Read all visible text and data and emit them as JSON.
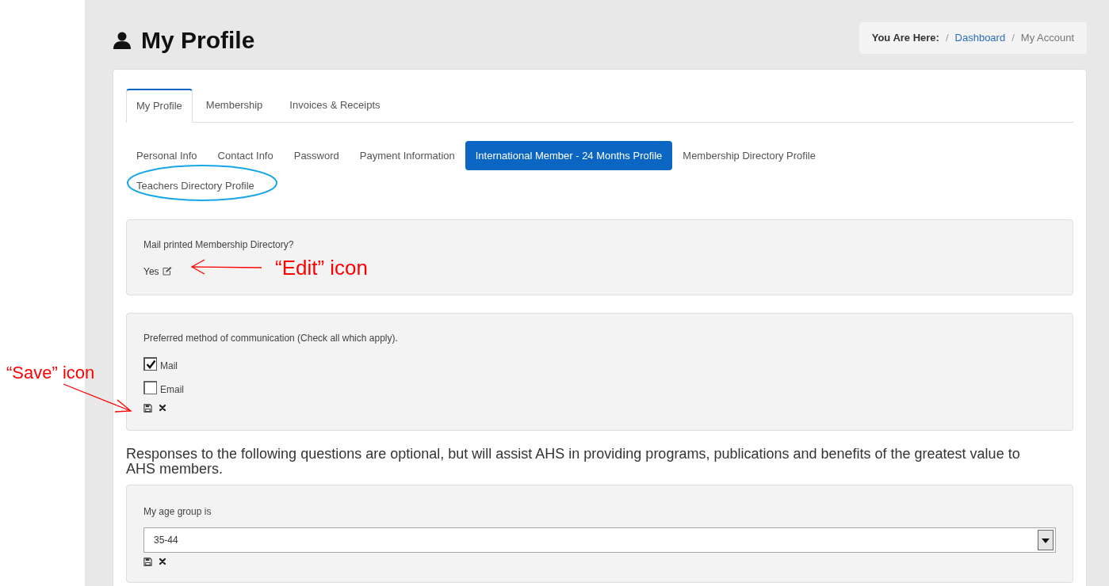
{
  "header": {
    "title": "My Profile",
    "breadcrumb": {
      "label": "You Are Here:",
      "items": [
        {
          "separator": "/",
          "text": "Dashboard",
          "kind": "link"
        },
        {
          "separator": "/",
          "text": "My Account",
          "kind": "current"
        }
      ]
    }
  },
  "tabs": [
    {
      "label": "My Profile",
      "selected": true
    },
    {
      "label": "Membership",
      "selected": false
    },
    {
      "label": "Invoices & Receipts",
      "selected": false
    }
  ],
  "subtabs": [
    {
      "label": "Personal Info",
      "selected": false
    },
    {
      "label": "Contact Info",
      "selected": false
    },
    {
      "label": "Password",
      "selected": false
    },
    {
      "label": "Payment Information",
      "selected": false
    },
    {
      "label": "International Member - 24 Months Profile",
      "selected": true
    },
    {
      "label": "Membership Directory Profile",
      "selected": false
    },
    {
      "label": "Teachers Directory Profile",
      "selected": false
    }
  ],
  "directory_question": {
    "label": "Mail printed Membership Directory?",
    "value": "Yes"
  },
  "communication": {
    "label": "Preferred method of communication (Check all which apply).",
    "options": [
      {
        "label": "Mail",
        "checked": true
      },
      {
        "label": "Email",
        "checked": false
      }
    ]
  },
  "intro": "Responses to the following questions are optional, but will assist AHS in providing programs, publications and benefits of the greatest value to AHS members.",
  "age_group": {
    "label": "My age group is",
    "value": "35-44"
  },
  "annotations": [
    {
      "text": "“Edit” icon"
    },
    {
      "text": "“Save” icon"
    }
  ]
}
